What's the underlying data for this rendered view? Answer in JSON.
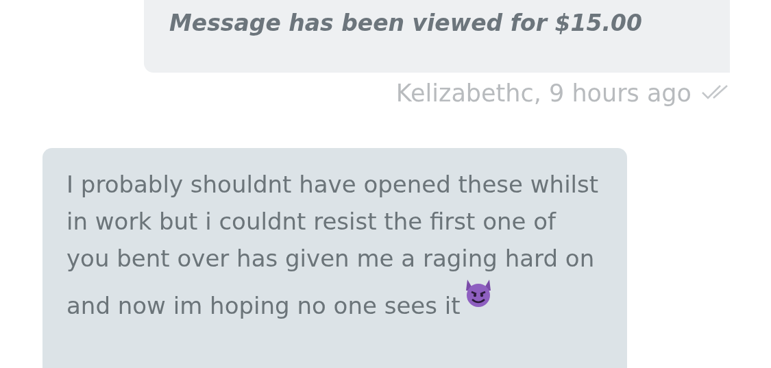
{
  "messages": [
    {
      "kind": "paid-notice",
      "text": "Message has been viewed for $15.00",
      "meta": "Kelizabethc, 9 hours ago",
      "read": true
    },
    {
      "kind": "incoming",
      "text": "I probably shouldnt have opened these whilst in work but i couldnt resist the first one of you bent over has given me a raging hard on and now im hoping no one sees it",
      "emoji": true
    }
  ]
}
